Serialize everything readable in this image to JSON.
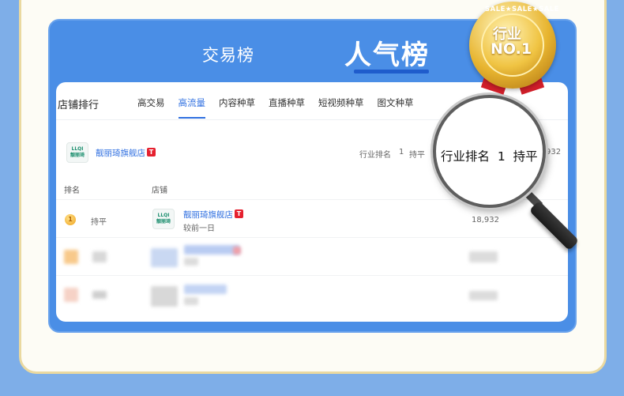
{
  "header_tabs": {
    "normal": "交易榜",
    "active": "人气榜"
  },
  "card": {
    "title": "店铺排行",
    "subtabs": [
      "高交易",
      "高流量",
      "内容种草",
      "直播种草",
      "短视频种草",
      "图文种草"
    ],
    "active_subtab": "高流量"
  },
  "shop_summary": {
    "logo_top": "LLQI",
    "logo_bottom": "靓丽琦",
    "name": "靓丽琦旗舰店",
    "badge": "T",
    "rank_label": "行业排名",
    "rank_value": "1",
    "trend": "持平",
    "value_partial": "932"
  },
  "table": {
    "columns": [
      "排名",
      "店铺"
    ],
    "rows": [
      {
        "medal": "1",
        "trend": "持平",
        "logo_top": "LLQI",
        "logo_bottom": "靓丽琦",
        "name": "靓丽琦旗舰店",
        "badge": "T",
        "sub": "较前一日",
        "value": "18,932"
      }
    ]
  },
  "magnifier": {
    "rank_label": "行业排名",
    "rank_value": "1",
    "trend": "持平"
  },
  "sale_badge": {
    "ring_text": "SALE★SALE★SALE",
    "line1": "行业",
    "line2": "NO.1"
  },
  "colors": {
    "blue_panel": "#4a8ee6",
    "accent": "#2f6fe0",
    "badge_red": "#e5202e",
    "gold": "#e8b530"
  }
}
